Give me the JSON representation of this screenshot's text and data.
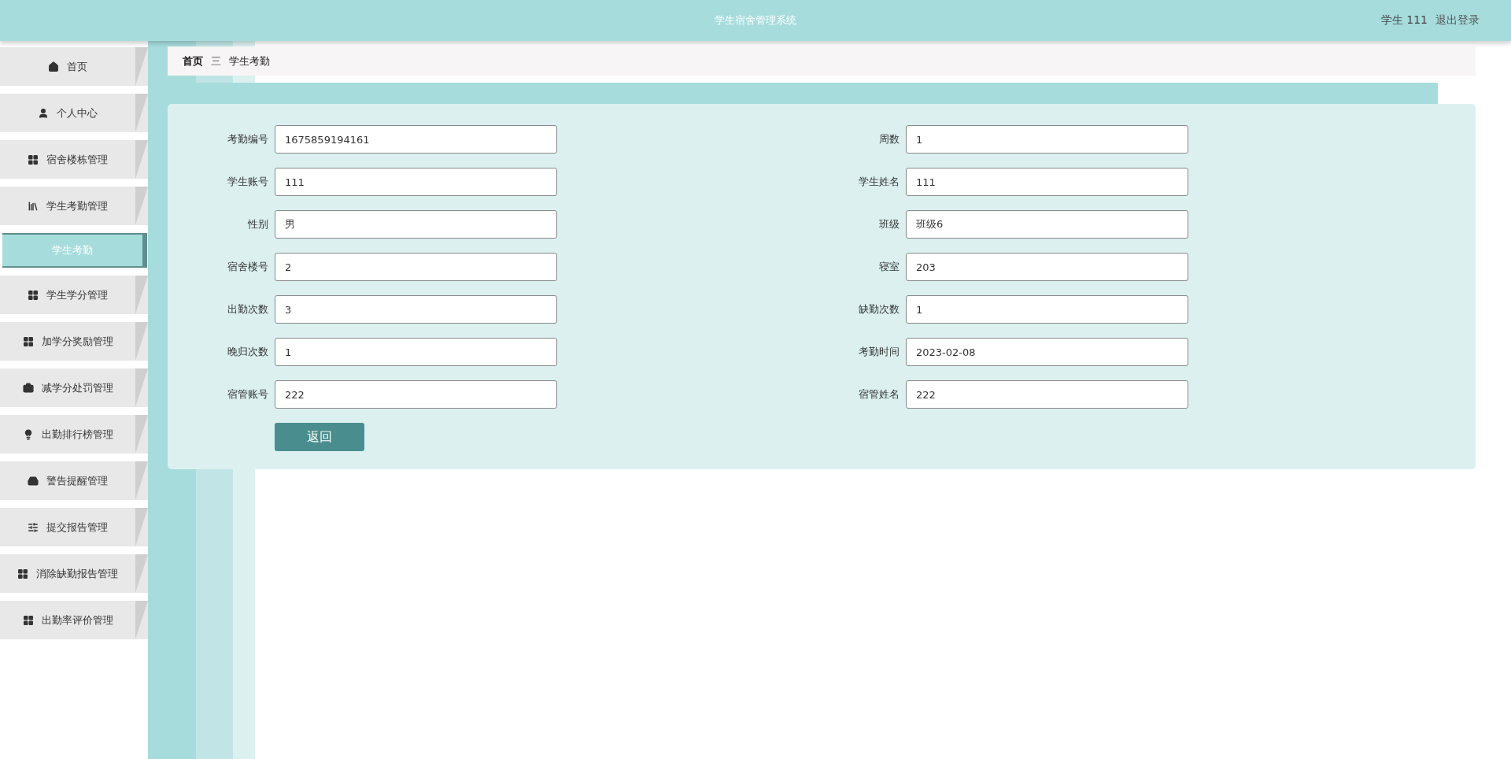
{
  "header": {
    "title": "学生宿舍管理系统",
    "user": "学生 111",
    "logout": "退出登录"
  },
  "sidebar": {
    "items": [
      {
        "label": "首页",
        "selected": false
      },
      {
        "label": "个人中心",
        "selected": false
      },
      {
        "label": "宿舍楼栋管理",
        "selected": false
      },
      {
        "label": "学生考勤管理",
        "selected": false,
        "children": [
          {
            "label": "学生考勤",
            "selected": true
          }
        ]
      },
      {
        "label": "学生学分管理",
        "selected": false
      },
      {
        "label": "加学分奖励管理",
        "selected": false
      },
      {
        "label": "减学分处罚管理",
        "selected": false
      },
      {
        "label": "出勤排行榜管理",
        "selected": false
      },
      {
        "label": "警告提醒管理",
        "selected": false
      },
      {
        "label": "提交报告管理",
        "selected": false
      },
      {
        "label": "消除缺勤报告管理",
        "selected": false
      },
      {
        "label": "出勤率评价管理",
        "selected": false
      }
    ]
  },
  "breadcrumb": {
    "home": "首页",
    "separator": "三",
    "current": "学生考勤"
  },
  "form": {
    "fields": [
      {
        "label": "考勤编号",
        "value": "1675859194161"
      },
      {
        "label": "周数",
        "value": "1"
      },
      {
        "label": "学生账号",
        "value": "111"
      },
      {
        "label": "学生姓名",
        "value": "111"
      },
      {
        "label": "性别",
        "value": "男"
      },
      {
        "label": "班级",
        "value": "班级6"
      },
      {
        "label": "宿舍楼号",
        "value": "2"
      },
      {
        "label": "寝室",
        "value": "203"
      },
      {
        "label": "出勤次数",
        "value": "3"
      },
      {
        "label": "缺勤次数",
        "value": "1"
      },
      {
        "label": "晚归次数",
        "value": "1"
      },
      {
        "label": "考勤时间",
        "value": "2023-02-08"
      },
      {
        "label": "宿管账号",
        "value": "222"
      },
      {
        "label": "宿管姓名",
        "value": "222"
      }
    ],
    "button": "返回"
  }
}
